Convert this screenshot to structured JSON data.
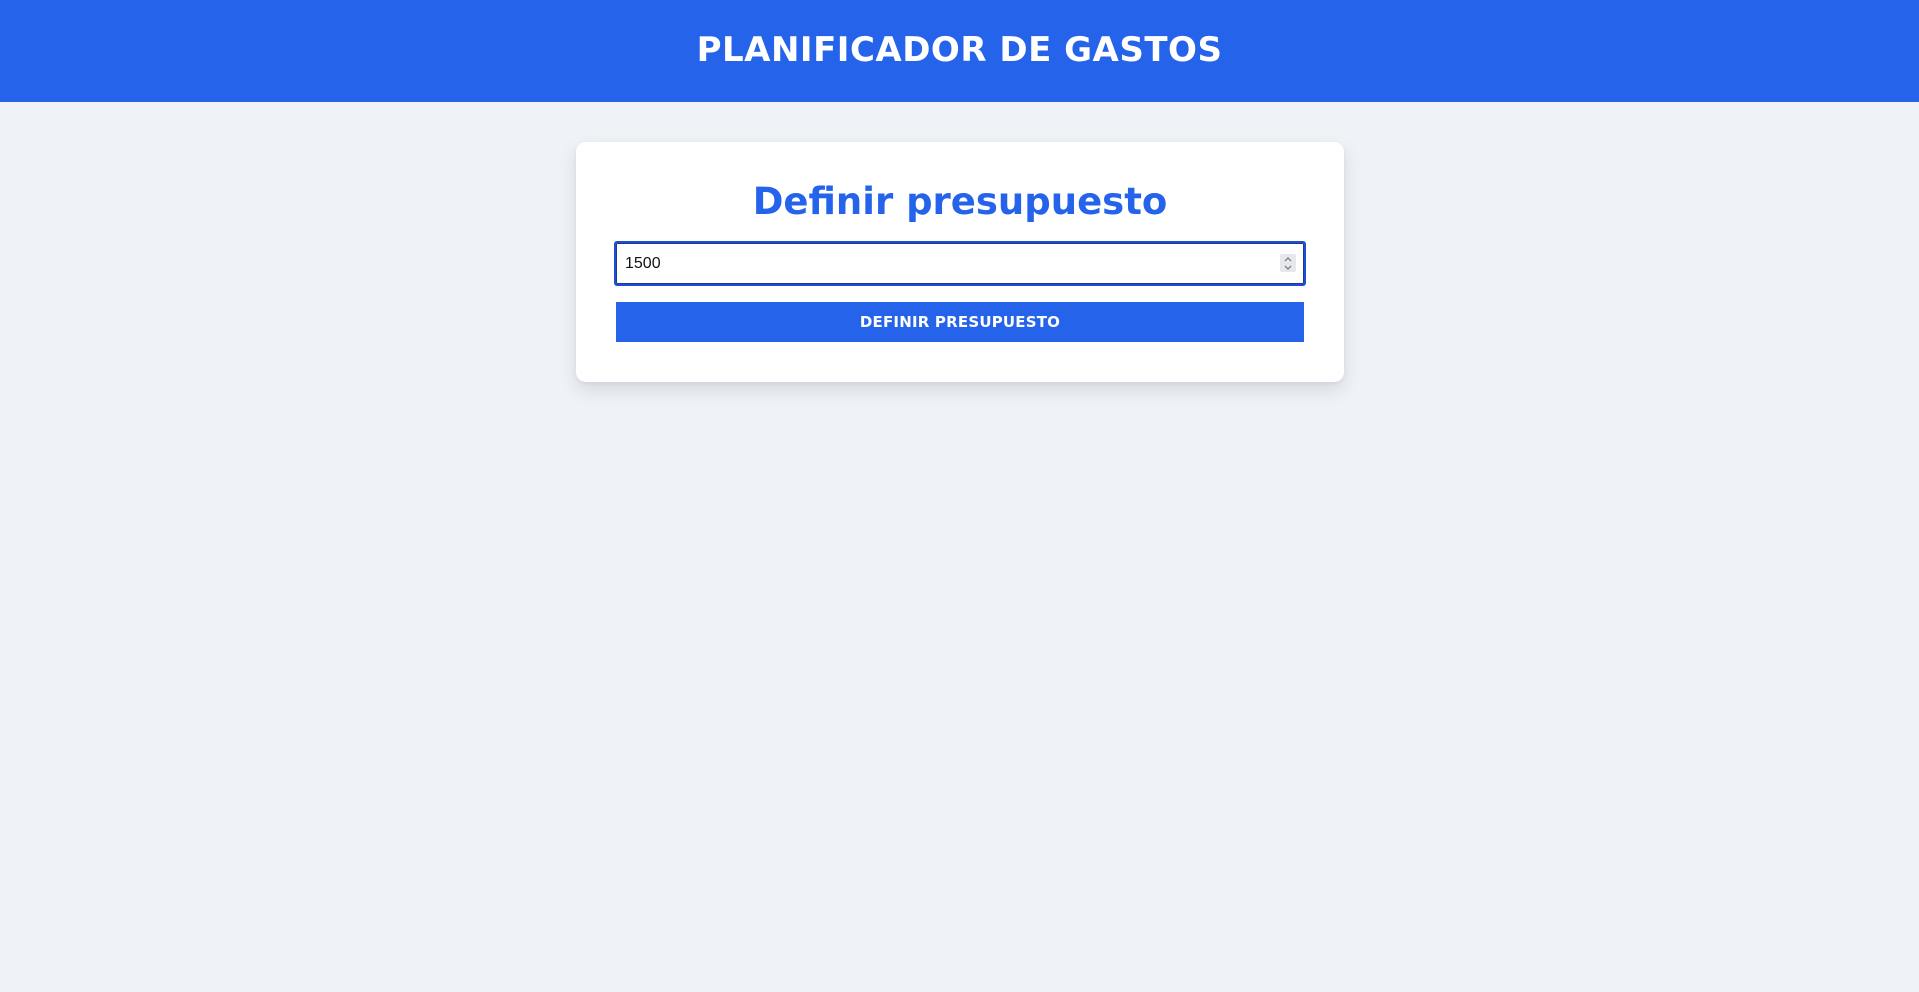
{
  "header": {
    "title": "PLANIFICADOR DE GASTOS"
  },
  "budget_form": {
    "title": "Definir presupuesto",
    "input_value": "1500",
    "input_type": "number",
    "submit_label": "DEFINIR PRESUPUESTO",
    "spinner_icons": [
      "chevron-up-icon",
      "chevron-down-icon"
    ]
  },
  "colors": {
    "accent": "#2563eb",
    "background": "#eff3f8",
    "card": "#ffffff",
    "input_focus_border": "#1d4ed8"
  }
}
